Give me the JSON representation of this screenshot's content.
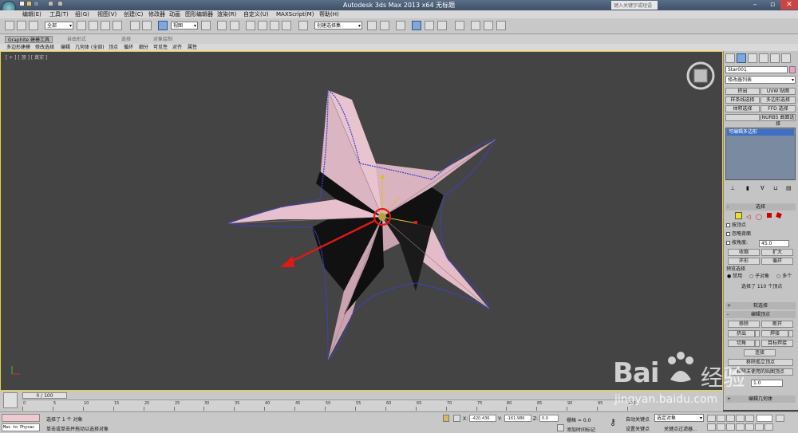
{
  "app": {
    "title": "Autodesk 3ds Max  2013 x64      无标题",
    "search_placeholder": "键入关键字或短语"
  },
  "menu": [
    "编辑(E)",
    "工具(T)",
    "组(G)",
    "视图(V)",
    "创建(C)",
    "修改器",
    "动画",
    "图形编辑器",
    "渲染(R)",
    "自定义(U)",
    "MAXScript(M)",
    "帮助(H)"
  ],
  "toolbar": {
    "selection_filter": "全部",
    "reference_coord": "视图",
    "named_selection": "创建选择集"
  },
  "ribbon": {
    "tabs": [
      "Graphite 建模工具",
      "自由形式",
      "选择",
      "对象绘制"
    ],
    "active_tab": "Graphite 建模工具",
    "sub_items": [
      "多边形建模",
      "修改选择",
      "编辑",
      "几何体 (全部)",
      "顶点",
      "循环",
      "细分",
      "可见性",
      "对齐",
      "属性"
    ]
  },
  "viewport": {
    "label": "[ + ] [ 顶 ] [ 真实 ]"
  },
  "command_panel": {
    "object_name": "Star001",
    "modifier_list": "修改器列表",
    "modifier_buttons": [
      "挤出",
      "UVW 贴图",
      "样条线选择",
      "多边形选择",
      "体积选择",
      "FFD 选择",
      "",
      "NURBS 曲面选择"
    ],
    "stack_item": "可编辑多边形",
    "selection": {
      "header": "选择",
      "by_vertex": "按顶点",
      "ignore_backfacing": "忽略背面",
      "by_angle": "按角度:",
      "angle_value": "45.0",
      "shrink": "收缩",
      "grow": "扩大",
      "ring": "环形",
      "loop": "循环",
      "preview_selection": "预览选择",
      "preview_options": [
        "禁用",
        "子对象",
        "多个"
      ],
      "status": "选择了 110 个顶点"
    },
    "soft_selection": "软选择",
    "edit_vertices": {
      "header": "编辑顶点",
      "buttons": [
        "移除",
        "断开",
        "挤出",
        "焊接",
        "切角",
        "目标焊接",
        "连接",
        "移除孤立顶点",
        "移除未使用的贴图顶点"
      ],
      "weight_value": "1.0"
    },
    "edit_geometry": "编辑几何体"
  },
  "timeline": {
    "slider": "0 / 100",
    "ticks": [
      "0",
      "5",
      "10",
      "15",
      "20",
      "25",
      "30",
      "35",
      "40",
      "45",
      "50",
      "55",
      "60",
      "65",
      "70",
      "75",
      "80",
      "85",
      "90",
      "95",
      "100"
    ]
  },
  "status": {
    "script_text": "Max to Physac",
    "line1": "选择了 1 个 对象",
    "line2": "单击或单击并拖动以选择对象",
    "x_label": "X:",
    "x_value": "-420.436",
    "y_label": "Y:",
    "y_value": "-161.986",
    "z_label": "Z:",
    "z_value": "0.0",
    "grid": "栅格 = 0.0",
    "add_time_tag": "添加时间标记",
    "auto_key": "自动关键点",
    "set_key": "设置关键点",
    "selected_object": "选定对象",
    "key_filters": "关键点过滤器..."
  },
  "watermark": {
    "brand": "Bai",
    "brand2": "经验",
    "url": "jingyan.baidu.com"
  }
}
